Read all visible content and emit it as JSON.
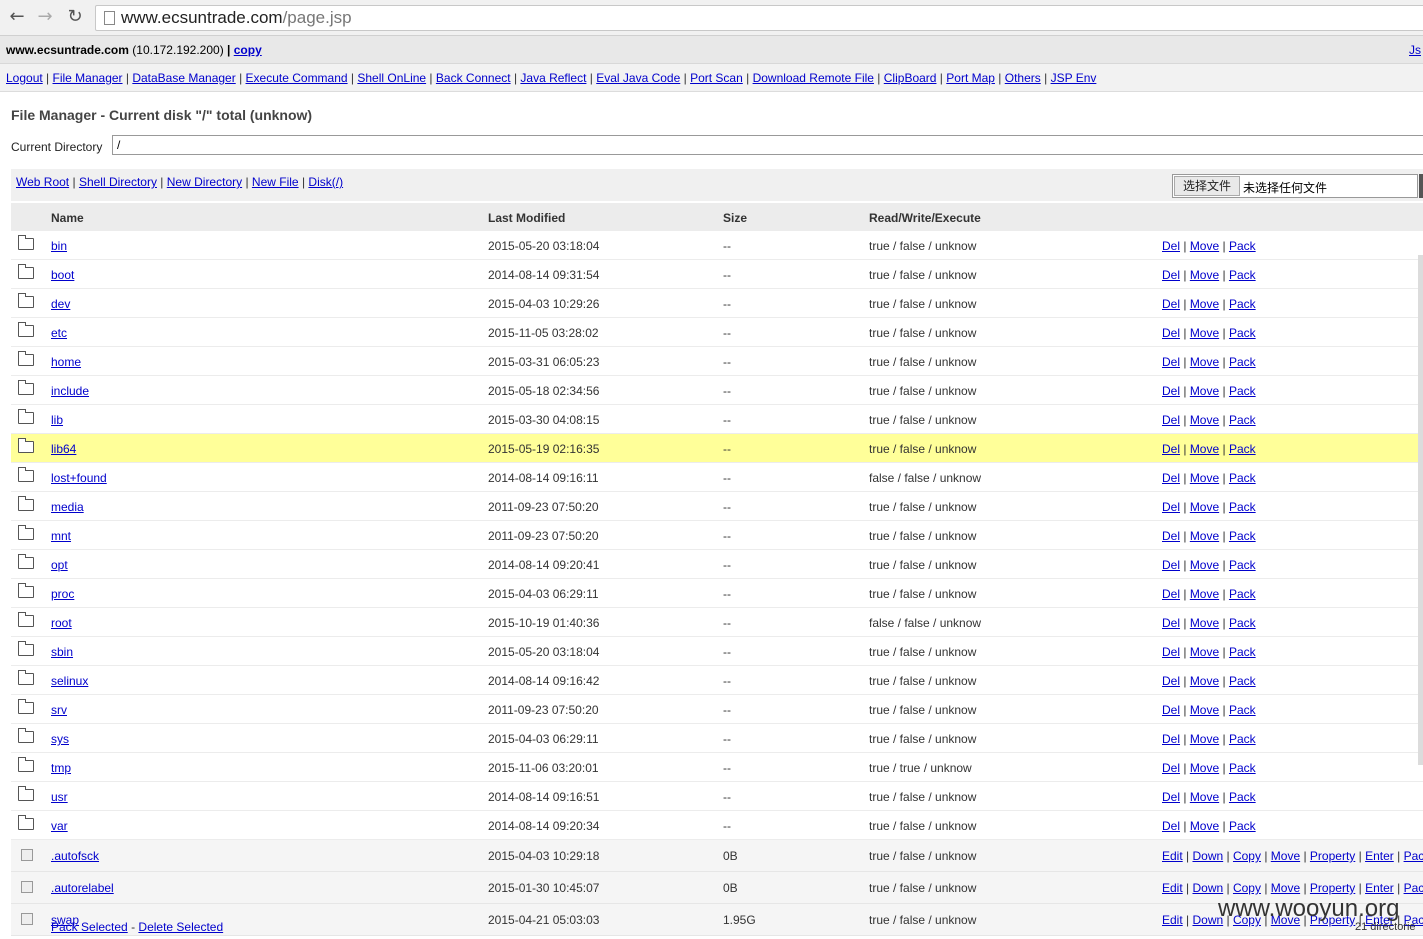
{
  "browser": {
    "url_host": "www.ecsuntrade.com",
    "url_path": "/page.jsp"
  },
  "header": {
    "host": "www.ecsuntrade.com",
    "ip": "(10.172.192.200)",
    "sep": "|",
    "copy": "copy",
    "js_link": "Js"
  },
  "menu": [
    "Logout",
    "File Manager",
    "DataBase Manager",
    "Execute Command",
    "Shell OnLine",
    "Back Connect",
    "Java Reflect",
    "Eval Java Code",
    "Port Scan",
    "Download Remote File",
    "ClipBoard",
    "Port Map",
    "Others",
    "JSP Env"
  ],
  "page": {
    "title": "File Manager - Current disk \"/\" total (unknow)",
    "current_directory_label": "Current Directory",
    "current_directory_value": "/"
  },
  "toolbar": {
    "links": [
      "Web Root",
      "Shell Directory",
      "New Directory",
      "New File",
      "Disk(/)"
    ],
    "file_button": "选择文件",
    "file_none": "未选择任何文件"
  },
  "table": {
    "headers": {
      "name": "Name",
      "modified": "Last Modified",
      "size": "Size",
      "rwx": "Read/Write/Execute"
    },
    "dir_actions": [
      "Del",
      "Move",
      "Pack"
    ],
    "file_actions": [
      "Edit",
      "Down",
      "Copy",
      "Move",
      "Property",
      "Enter",
      "Pac"
    ],
    "dirs": [
      {
        "name": "bin",
        "modified": "2015-05-20 03:18:04",
        "size": "--",
        "rwx": "true / false / unknow"
      },
      {
        "name": "boot",
        "modified": "2014-08-14 09:31:54",
        "size": "--",
        "rwx": "true / false / unknow"
      },
      {
        "name": "dev",
        "modified": "2015-04-03 10:29:26",
        "size": "--",
        "rwx": "true / false / unknow"
      },
      {
        "name": "etc",
        "modified": "2015-11-05 03:28:02",
        "size": "--",
        "rwx": "true / false / unknow"
      },
      {
        "name": "home",
        "modified": "2015-03-31 06:05:23",
        "size": "--",
        "rwx": "true / false / unknow"
      },
      {
        "name": "include",
        "modified": "2015-05-18 02:34:56",
        "size": "--",
        "rwx": "true / false / unknow"
      },
      {
        "name": "lib",
        "modified": "2015-03-30 04:08:15",
        "size": "--",
        "rwx": "true / false / unknow"
      },
      {
        "name": "lib64",
        "modified": "2015-05-19 02:16:35",
        "size": "--",
        "rwx": "true / false / unknow",
        "highlight": true
      },
      {
        "name": "lost+found",
        "modified": "2014-08-14 09:16:11",
        "size": "--",
        "rwx": "false / false / unknow"
      },
      {
        "name": "media",
        "modified": "2011-09-23 07:50:20",
        "size": "--",
        "rwx": "true / false / unknow"
      },
      {
        "name": "mnt",
        "modified": "2011-09-23 07:50:20",
        "size": "--",
        "rwx": "true / false / unknow"
      },
      {
        "name": "opt",
        "modified": "2014-08-14 09:20:41",
        "size": "--",
        "rwx": "true / false / unknow"
      },
      {
        "name": "proc",
        "modified": "2015-04-03 06:29:11",
        "size": "--",
        "rwx": "true / false / unknow"
      },
      {
        "name": "root",
        "modified": "2015-10-19 01:40:36",
        "size": "--",
        "rwx": "false / false / unknow"
      },
      {
        "name": "sbin",
        "modified": "2015-05-20 03:18:04",
        "size": "--",
        "rwx": "true / false / unknow"
      },
      {
        "name": "selinux",
        "modified": "2014-08-14 09:16:42",
        "size": "--",
        "rwx": "true / false / unknow"
      },
      {
        "name": "srv",
        "modified": "2011-09-23 07:50:20",
        "size": "--",
        "rwx": "true / false / unknow"
      },
      {
        "name": "sys",
        "modified": "2015-04-03 06:29:11",
        "size": "--",
        "rwx": "true / false / unknow"
      },
      {
        "name": "tmp",
        "modified": "2015-11-06 03:20:01",
        "size": "--",
        "rwx": "true / true / unknow"
      },
      {
        "name": "usr",
        "modified": "2014-08-14 09:16:51",
        "size": "--",
        "rwx": "true / false / unknow"
      },
      {
        "name": "var",
        "modified": "2014-08-14 09:20:34",
        "size": "--",
        "rwx": "true / false / unknow"
      }
    ],
    "files": [
      {
        "name": ".autofsck",
        "modified": "2015-04-03 10:29:18",
        "size": "0B",
        "rwx": "true / false / unknow"
      },
      {
        "name": ".autorelabel",
        "modified": "2015-01-30 10:45:07",
        "size": "0B",
        "rwx": "true / false / unknow"
      },
      {
        "name": "swap",
        "modified": "2015-04-21 05:03:03",
        "size": "1.95G",
        "rwx": "true / false / unknow"
      }
    ]
  },
  "footer": {
    "pack_selected": "Pack Selected",
    "delete_selected": "Delete Selected",
    "dash": "-",
    "summary": "21 directorie"
  },
  "watermark": "www.wooyun.org"
}
